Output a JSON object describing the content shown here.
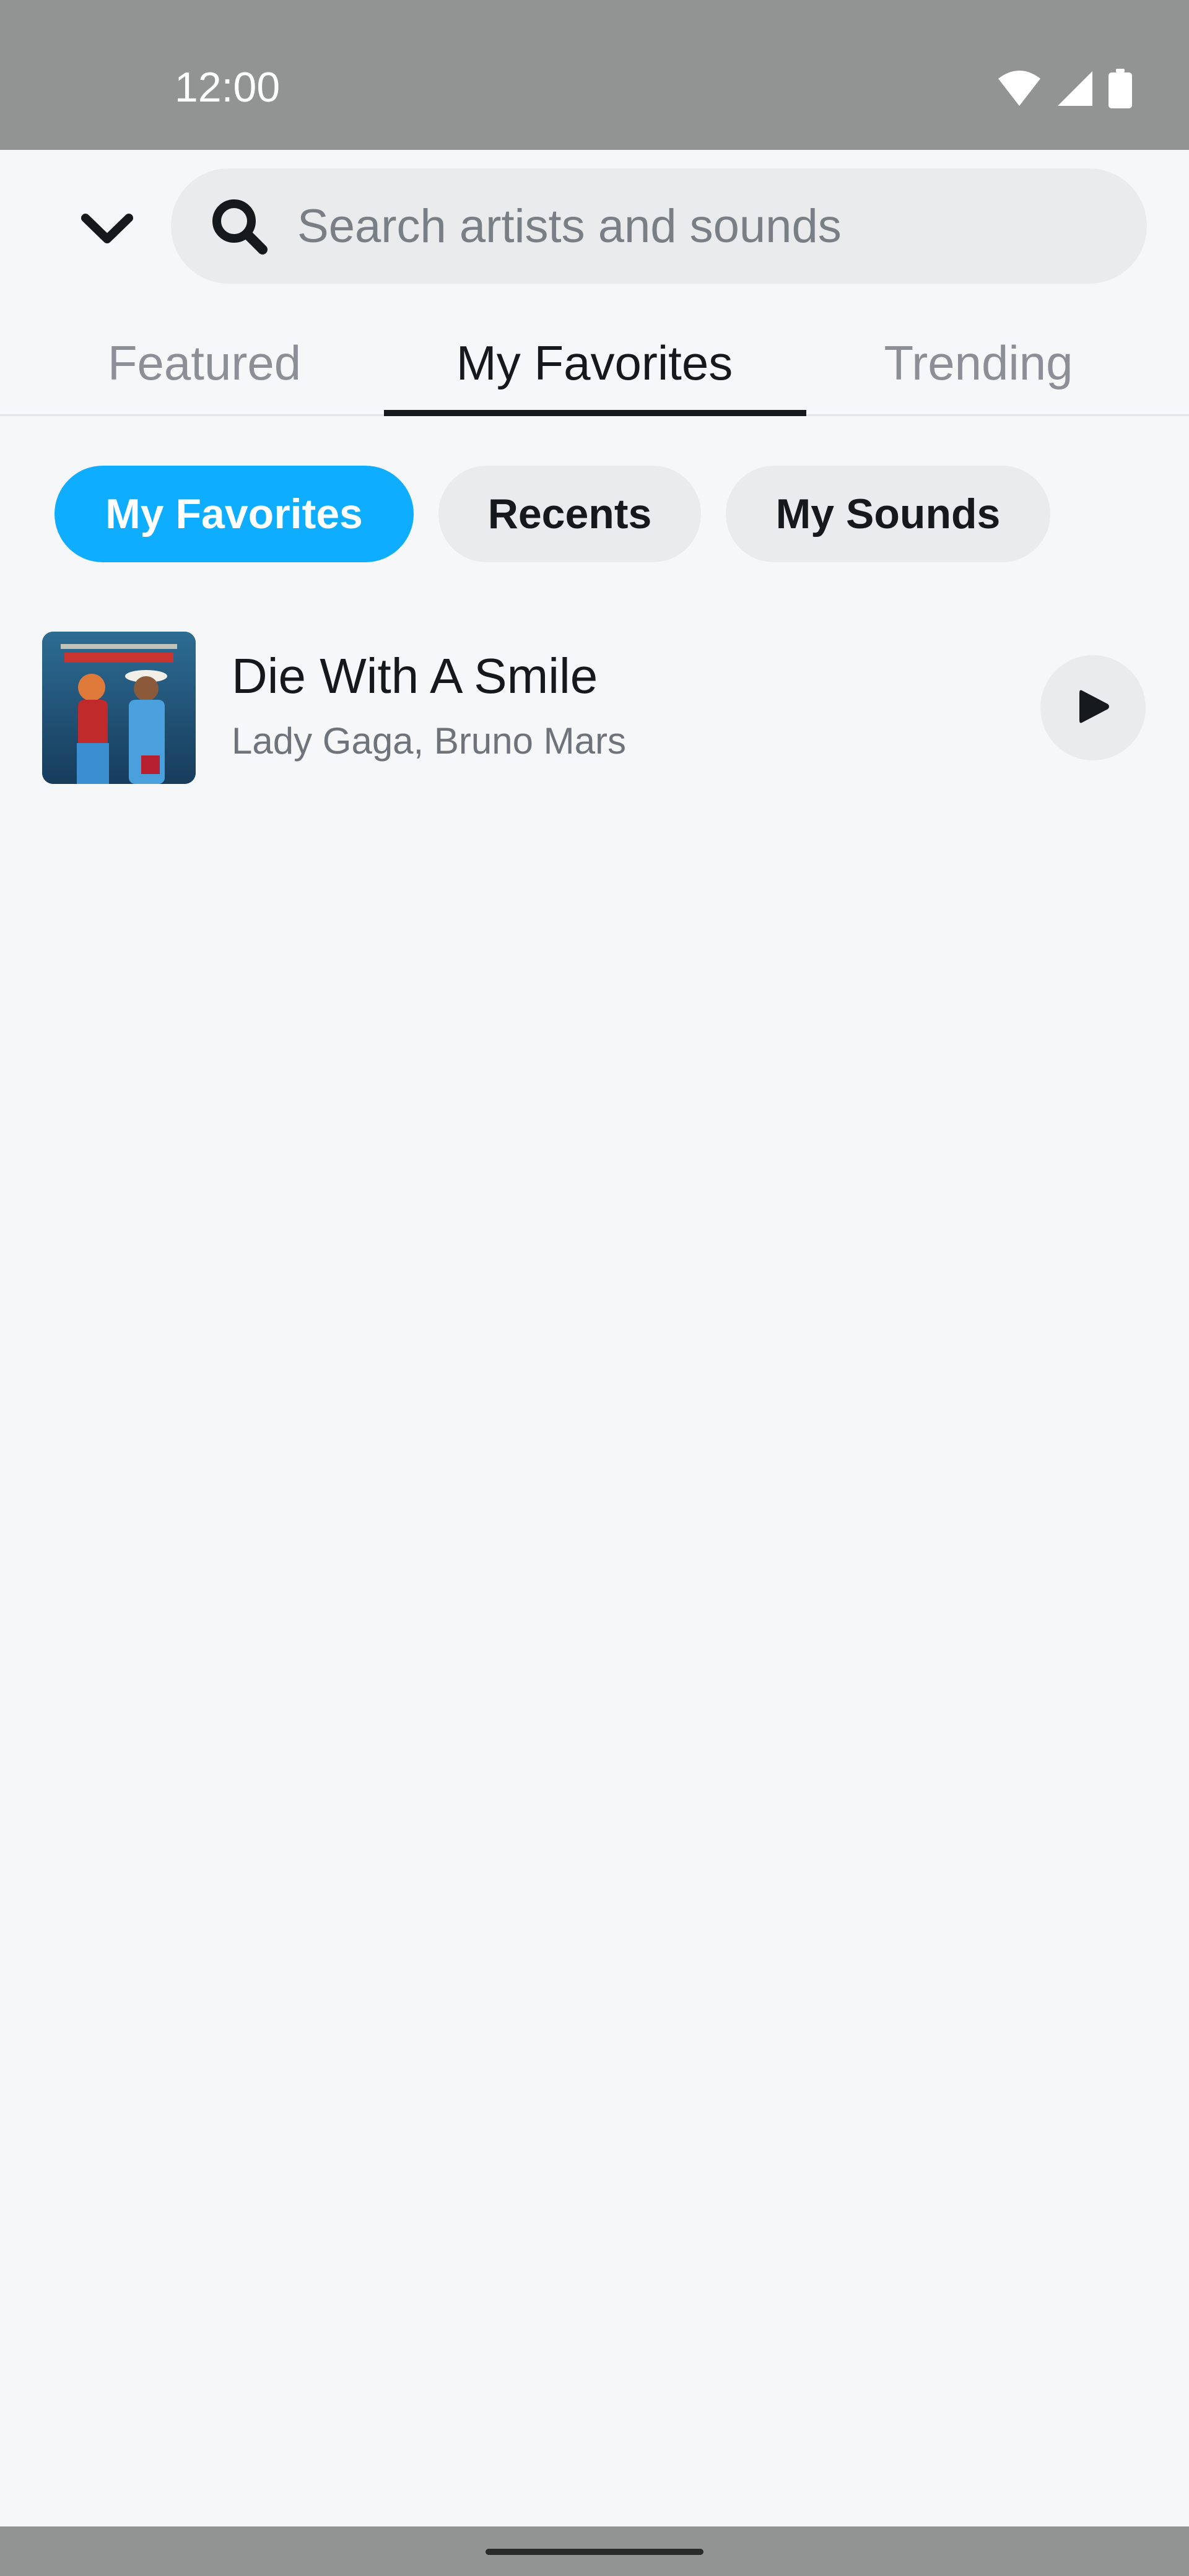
{
  "status_bar": {
    "time": "12:00",
    "icons": [
      "wifi-icon",
      "signal-icon",
      "battery-icon"
    ]
  },
  "header": {
    "back_icon": "chevron-down-icon",
    "search": {
      "icon": "search-icon",
      "placeholder": "Search artists and sounds"
    }
  },
  "tabs": [
    {
      "label": "Featured",
      "selected": false
    },
    {
      "label": "My Favorites",
      "selected": true
    },
    {
      "label": "Trending",
      "selected": false
    }
  ],
  "chips": [
    {
      "label": "My Favorites",
      "selected": true
    },
    {
      "label": "Recents",
      "selected": false
    },
    {
      "label": "My Sounds",
      "selected": false
    }
  ],
  "songs": [
    {
      "title": "Die With A Smile",
      "artist": "Lady Gaga, Bruno Mars",
      "play_icon": "play-icon"
    }
  ],
  "colors": {
    "accent": "#0FADFF",
    "background": "#F5F7F9",
    "system_bar": "#929393",
    "chip_background": "#E9EBED",
    "text_primary": "#16191C",
    "text_secondary": "#6F747A"
  }
}
